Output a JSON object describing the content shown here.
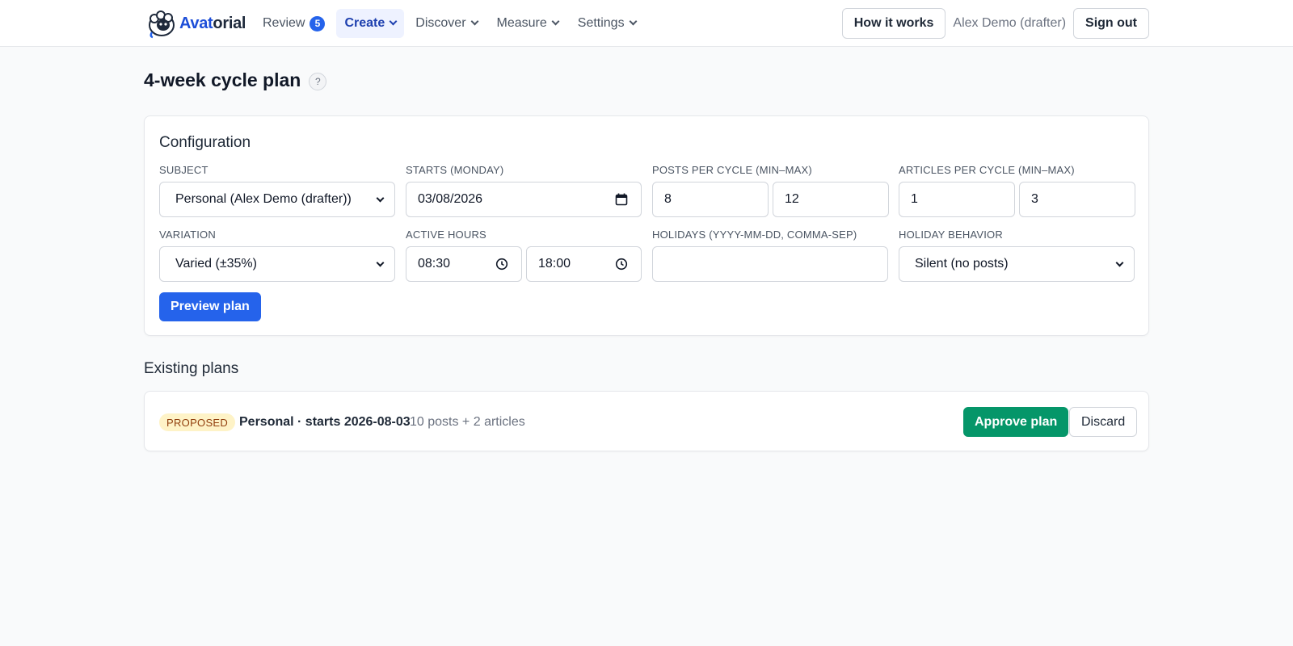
{
  "brand": {
    "name_part1": "Avat",
    "name_part2": "orial",
    "accent": "#2563eb"
  },
  "nav": {
    "review": {
      "label": "Review",
      "count": "5"
    },
    "create": {
      "label": "Create"
    },
    "discover": {
      "label": "Discover"
    },
    "measure": {
      "label": "Measure"
    },
    "settings": {
      "label": "Settings"
    }
  },
  "header": {
    "how_it_works": "How it works",
    "user": "Alex Demo (drafter)",
    "sign_out": "Sign out"
  },
  "page": {
    "title": "4-week cycle plan",
    "help": "?"
  },
  "config": {
    "heading": "Configuration",
    "subject": {
      "label": "SUBJECT",
      "value": "Personal (Alex Demo (drafter))"
    },
    "starts": {
      "label": "STARTS (MONDAY)",
      "value": "03/08/2026"
    },
    "posts": {
      "label": "POSTS PER CYCLE (MIN–MAX)",
      "min": "8",
      "max": "12"
    },
    "articles": {
      "label": "ARTICLES PER CYCLE (MIN–MAX)",
      "min": "1",
      "max": "3"
    },
    "variation": {
      "label": "VARIATION",
      "value": "Varied (±35%)"
    },
    "active_hours": {
      "label": "ACTIVE HOURS",
      "start": "08:30",
      "end": "18:00"
    },
    "holidays": {
      "label": "HOLIDAYS (YYYY-MM-DD, COMMA-SEP)",
      "value": ""
    },
    "holiday_behavior": {
      "label": "HOLIDAY BEHAVIOR",
      "value": "Silent (no posts)"
    },
    "preview_button": "Preview plan"
  },
  "existing": {
    "title": "Existing plans",
    "plans": [
      {
        "status": "PROPOSED",
        "name": "Personal · starts 2026-08-03",
        "summary": "10 posts + 2 articles",
        "approve": "Approve plan",
        "discard": "Discard"
      }
    ]
  }
}
